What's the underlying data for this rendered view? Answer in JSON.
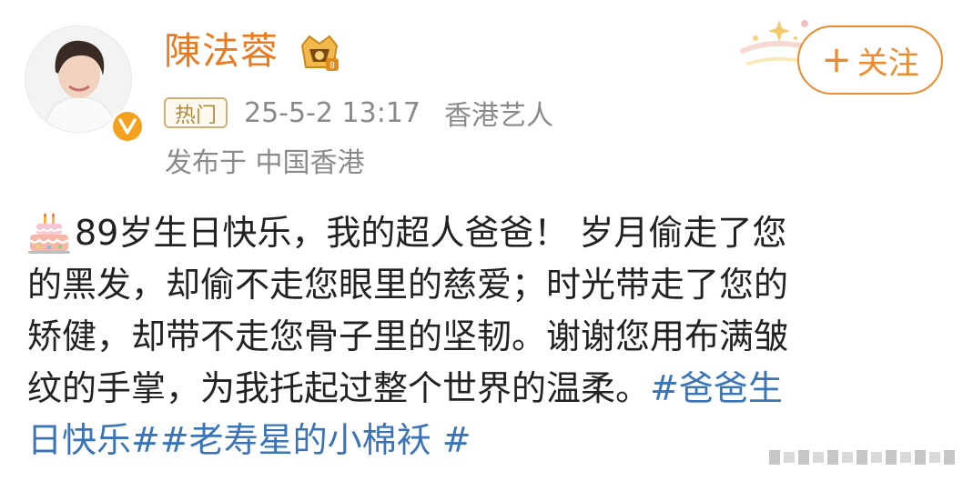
{
  "post": {
    "author": {
      "name": "陳法蓉",
      "avatar_icon": "user-avatar-photo",
      "verified_icon": "verified-v-badge",
      "vip_icon": "vip-crown-badge"
    },
    "meta": {
      "hot_tag": "热门",
      "timestamp": "25-5-2 13:17",
      "identity": "香港艺人",
      "location": "发布于 中国香港"
    },
    "follow_button": {
      "plus": "+",
      "label": "关注"
    },
    "content": {
      "emoji_icon": "birthday-cake-icon",
      "lines": [
        "89岁生日快乐，我的超人爸爸！ 岁月偷走了您",
        "的黑发，却偷不走您眼里的慈爱；时光带走了您的",
        "矫健，却带不走您骨子里的坚韧。谢谢您用布满皱",
        "纹的手掌，为我托起过整个世界的温柔。"
      ],
      "hashtag_1_part1": "#爸爸生",
      "hashtag_1_part2": "日快乐#",
      "hashtag_2": "#老寿星的小棉袄 #"
    },
    "colors": {
      "username": "#ea7a1e",
      "follow": "#ed8a2e",
      "hashtag": "#3a74b8",
      "meta": "#8a8a8a",
      "text": "#222222"
    }
  }
}
